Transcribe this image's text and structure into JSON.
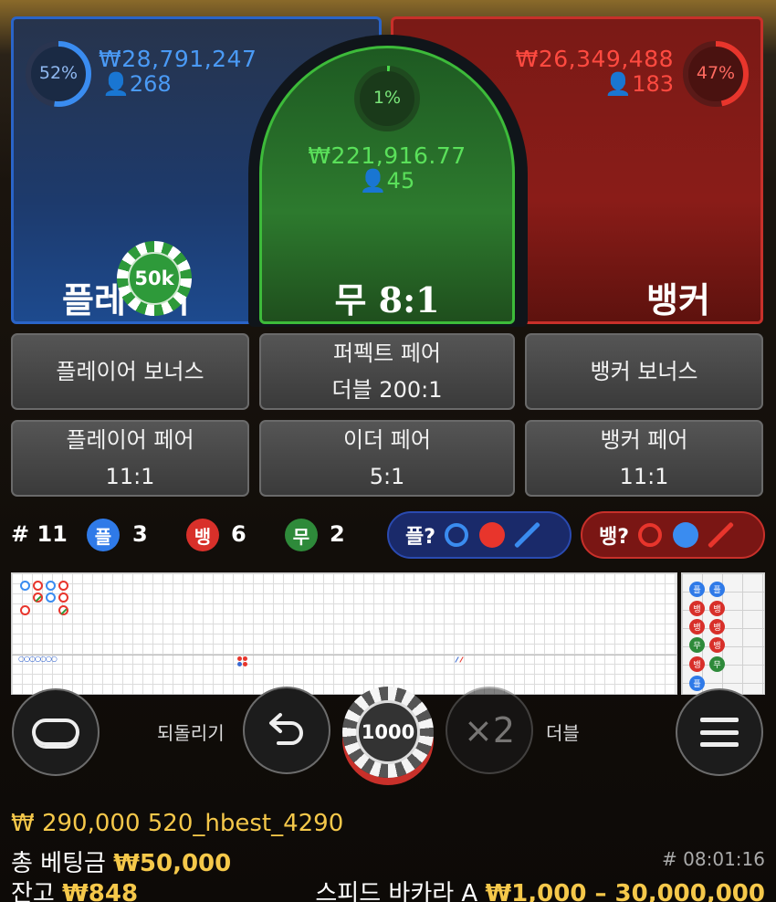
{
  "player": {
    "percent": "52%",
    "amount": "₩28,791,247",
    "users": "268",
    "label": "플레이어",
    "color": "#3a8cf0"
  },
  "tie": {
    "percent": "1%",
    "amount": "₩221,916.77",
    "users": "45",
    "label": "무 8:1",
    "color": "#4ad84a"
  },
  "banker": {
    "percent": "47%",
    "amount": "₩26,349,488",
    "users": "183",
    "label": "뱅커",
    "color": "#e8352c"
  },
  "placed_chip": "50k",
  "side_bets": [
    {
      "line1": "플레이어 보너스",
      "line2": ""
    },
    {
      "line1": "퍼펙트 페어",
      "line2": "더블 200:1"
    },
    {
      "line1": "뱅커 보너스",
      "line2": ""
    },
    {
      "line1": "플레이어 페어",
      "line2": "11:1"
    },
    {
      "line1": "이더 페어",
      "line2": "5:1"
    },
    {
      "line1": "뱅커 페어",
      "line2": "11:1"
    }
  ],
  "stats": {
    "round": "# 11",
    "player_symbol": "플",
    "player_count": "3",
    "banker_symbol": "뱅",
    "banker_count": "6",
    "tie_symbol": "무",
    "tie_count": "2",
    "player_predict": "플?",
    "banker_predict": "뱅?"
  },
  "bead_road": [
    "플",
    "플",
    "뱅",
    "뱅",
    "뱅",
    "뱅",
    "무",
    "뱅",
    "뱅",
    "무",
    "플"
  ],
  "controls": {
    "undo_label": "되돌리기",
    "chip_value": "1000",
    "double_symbol": "×2",
    "double_label": "더블"
  },
  "footer": {
    "balance_line": "₩ 290,000 520_hbest_4290",
    "total_bet_label": "총 베팅금",
    "total_bet_value": "₩50,000",
    "balance_label": "잔고",
    "balance_value": "₩848",
    "round_id": "# 08:01:16",
    "table_name": "스피드 바카라 A",
    "limits": "₩1,000 – 30,000,000"
  }
}
